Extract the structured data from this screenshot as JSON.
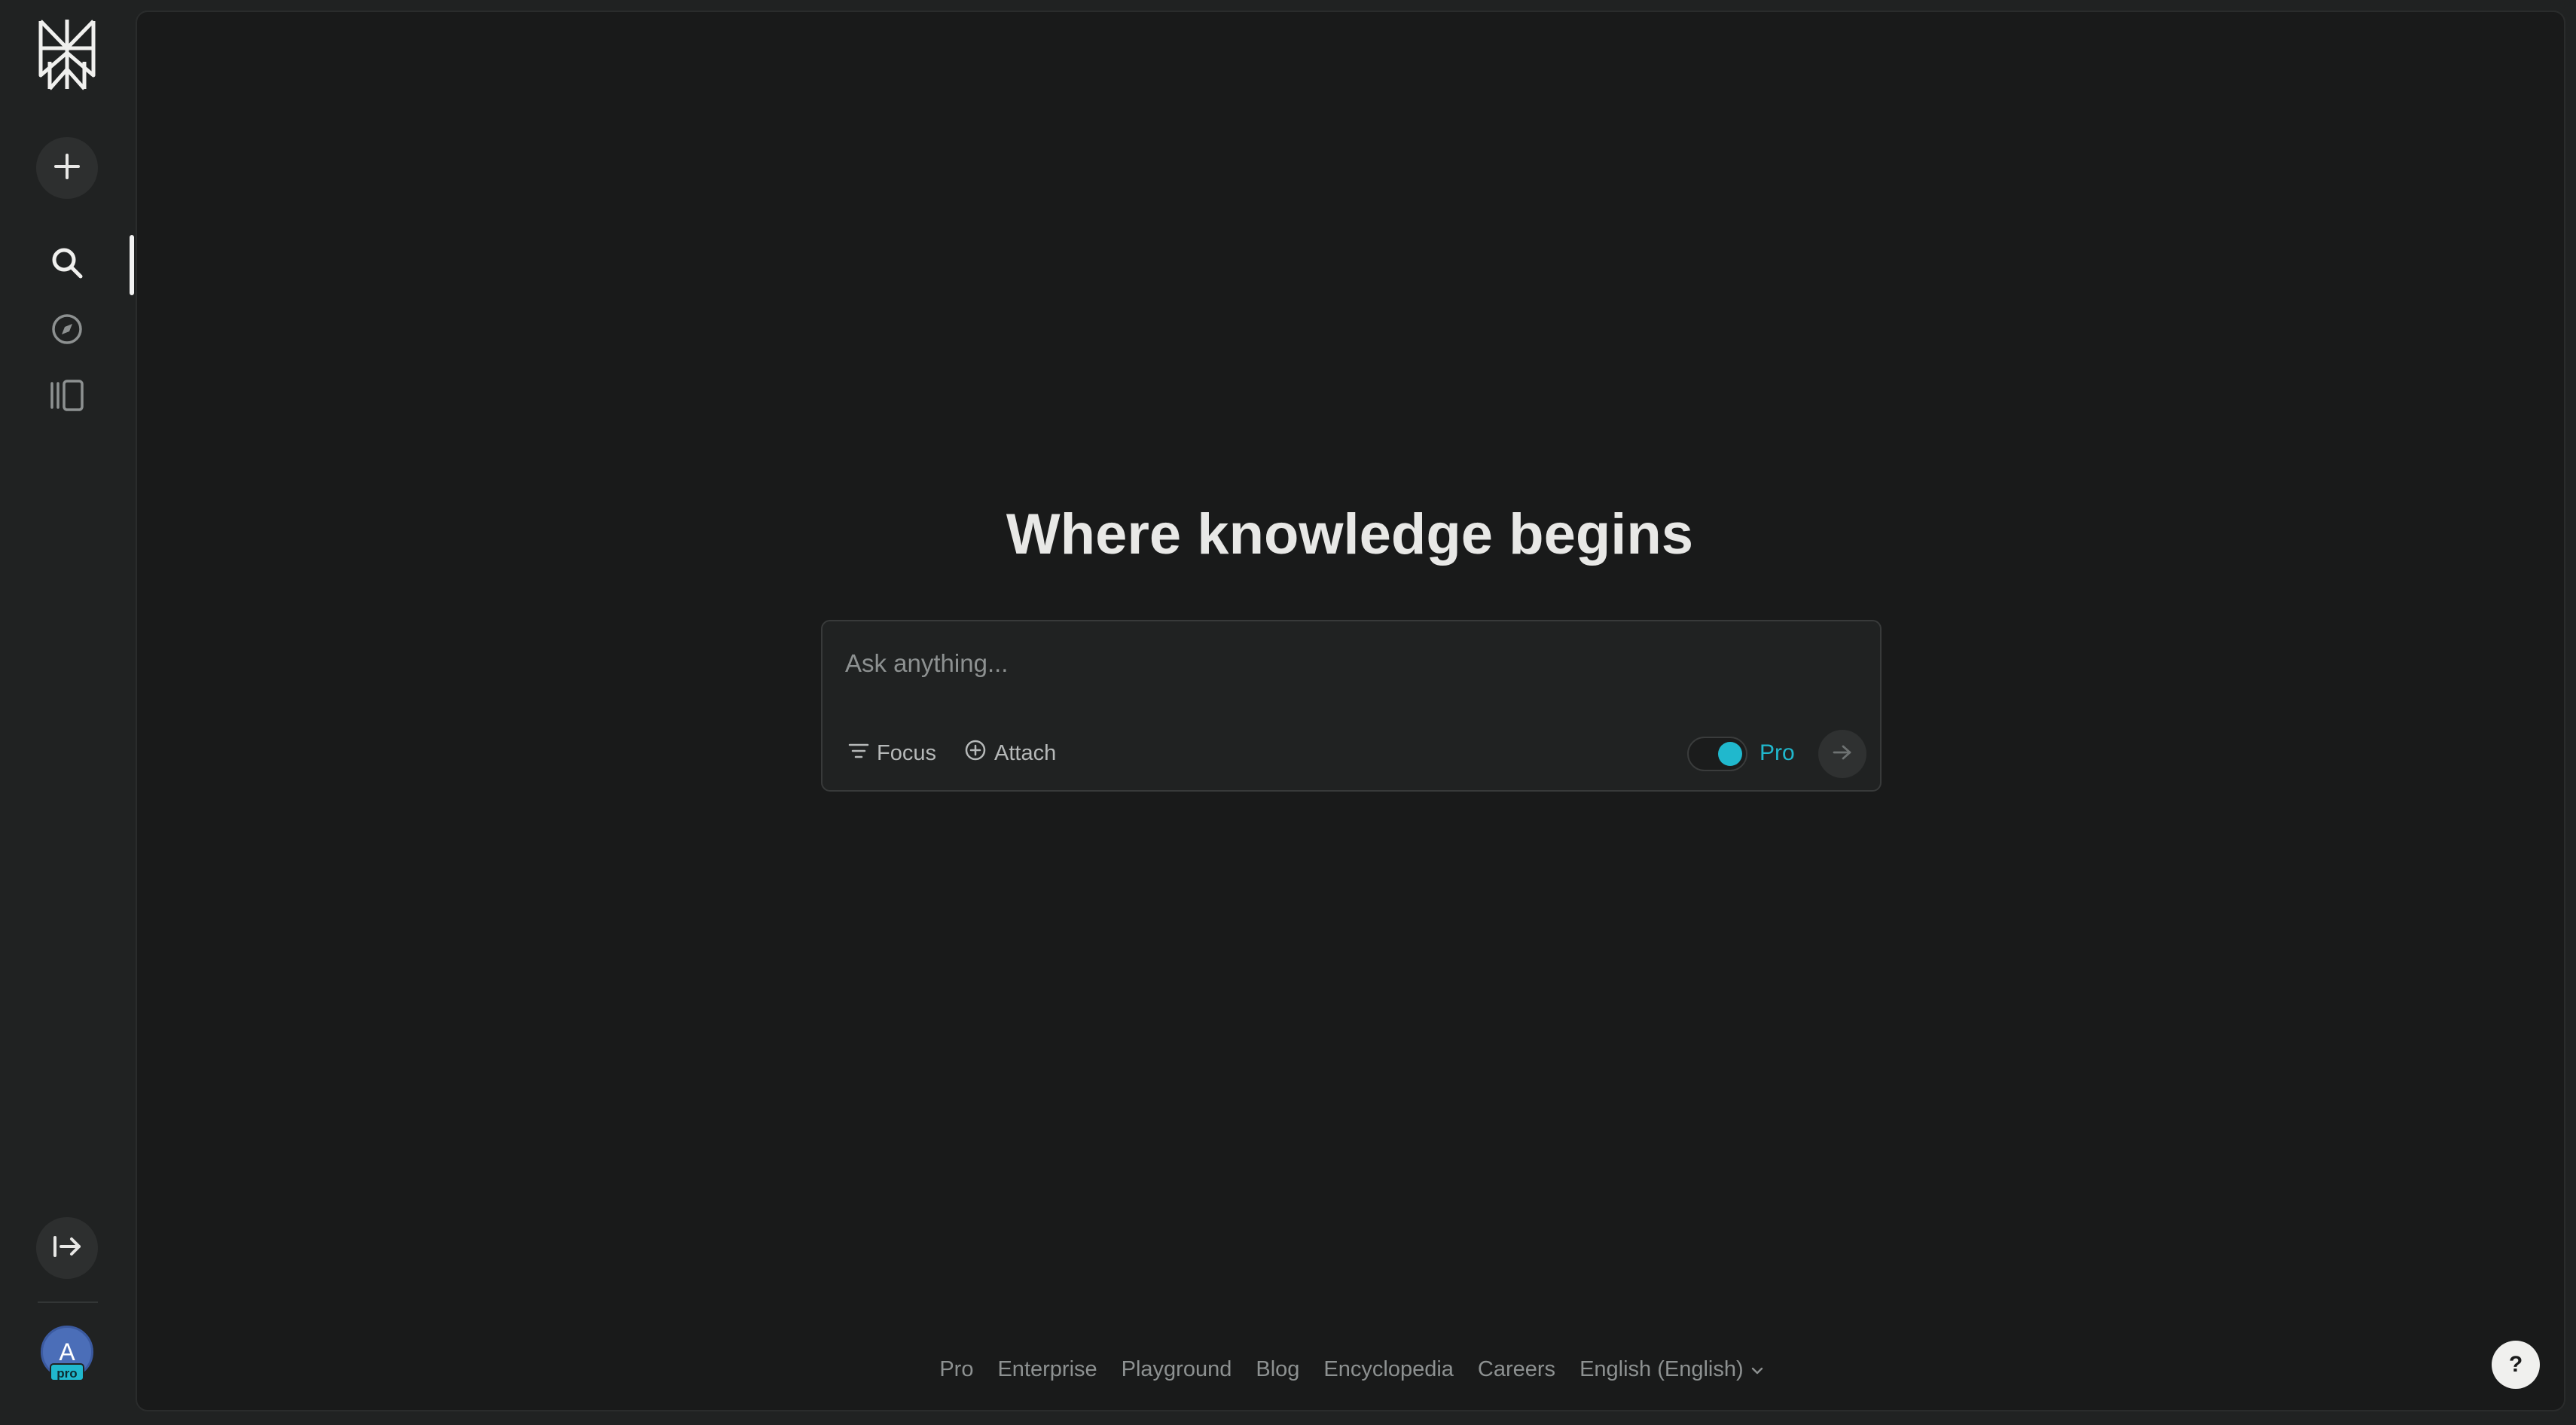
{
  "sidebar": {
    "new_label": "New Thread",
    "nav": [
      {
        "icon": "search-icon",
        "active": true
      },
      {
        "icon": "compass-icon",
        "active": false
      },
      {
        "icon": "library-icon",
        "active": false
      }
    ],
    "avatar_initial": "A",
    "avatar_badge": "pro"
  },
  "main": {
    "headline": "Where knowledge begins",
    "search": {
      "placeholder": "Ask anything...",
      "value": "",
      "focus_label": "Focus",
      "attach_label": "Attach",
      "pro_label": "Pro",
      "pro_enabled": true
    }
  },
  "footer": {
    "links": [
      "Pro",
      "Enterprise",
      "Playground",
      "Blog",
      "Encyclopedia",
      "Careers"
    ],
    "language": "English (English)"
  },
  "help_label": "?",
  "colors": {
    "accent": "#20b8cd",
    "background": "#191a1a",
    "sidebar": "#202222",
    "text": "#e8e8e6",
    "muted": "#8d9191"
  }
}
